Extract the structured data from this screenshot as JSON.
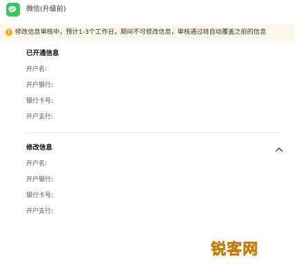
{
  "header": {
    "app_icon": "wechat-icon",
    "title": "微信(升级前)"
  },
  "notice": {
    "icon": "warning-icon",
    "text": "修改信息审核中，预计1-3个工作日，期间不可修改信息，审核通过将自动覆盖之前的信息"
  },
  "opened_info": {
    "title": "已开通信息",
    "fields": [
      "开户名:",
      "开户银行:",
      "银行卡号:",
      "开户支行:"
    ]
  },
  "modified_info": {
    "title": "修改信息",
    "collapse_icon": "chevron-up-icon",
    "fields": [
      "开户名:",
      "开户银行:",
      "银行卡号:",
      "开户支行:"
    ]
  },
  "watermark": "锐客网",
  "colors": {
    "wechat_green": "#3cc75c",
    "warning": "#f0a81c",
    "notice_bg": "#fdf8ea"
  }
}
